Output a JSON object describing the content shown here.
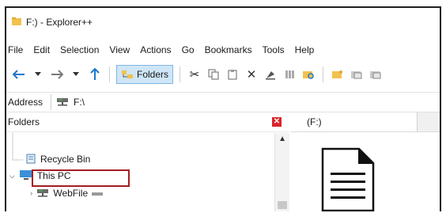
{
  "window": {
    "title": "F:) - Explorer++"
  },
  "menu": {
    "items": [
      "File",
      "Edit",
      "Selection",
      "View",
      "Actions",
      "Go",
      "Bookmarks",
      "Tools",
      "Help"
    ]
  },
  "toolbar": {
    "folders_label": "Folders"
  },
  "address": {
    "label": "Address",
    "value": "F:\\"
  },
  "folders_pane": {
    "title": "Folders",
    "tree": [
      "Recycle Bin",
      "This PC",
      "WebFile"
    ]
  },
  "tab": {
    "label": "(F:)"
  },
  "colors": {
    "accent": "#1e78c8",
    "highlight": "#a51c23",
    "close": "#d9242b"
  }
}
